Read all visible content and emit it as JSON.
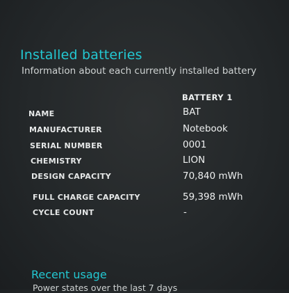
{
  "installed": {
    "title": "Installed batteries",
    "subtitle": "Information about each currently installed battery",
    "column_header": "BATTERY 1",
    "rows": [
      {
        "label": "NAME",
        "value": "BAT"
      },
      {
        "label": "MANUFACTURER",
        "value": "Notebook"
      },
      {
        "label": "SERIAL NUMBER",
        "value": "0001"
      },
      {
        "label": "CHEMISTRY",
        "value": "LION"
      },
      {
        "label": "DESIGN CAPACITY",
        "value": "70,840 mWh"
      },
      {
        "label": "FULL CHARGE CAPACITY",
        "value": "59,398 mWh"
      },
      {
        "label": "CYCLE COUNT",
        "value": "-"
      }
    ]
  },
  "recent": {
    "title": "Recent usage",
    "subtitle": "Power states over the last 7 days"
  }
}
